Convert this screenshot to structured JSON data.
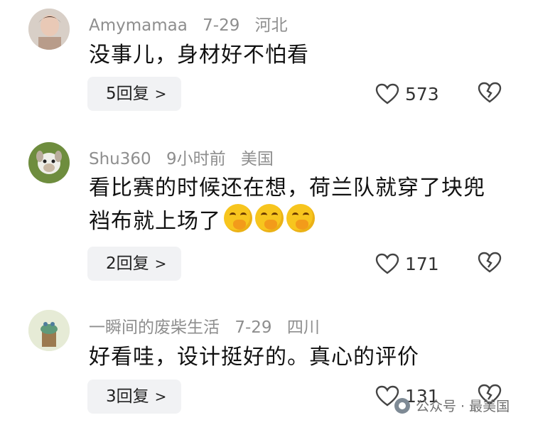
{
  "comments": [
    {
      "username": "Amymamaa",
      "date": "7-29",
      "location": "河北",
      "text": "没事儿，身材好不怕看",
      "replies_label": "5回复",
      "likes": "573"
    },
    {
      "username": "Shu360",
      "date": "9小时前",
      "location": "美国",
      "text": "看比赛的时候还在想，荷兰队就穿了块兜裆布就上场了",
      "emojis": [
        "face-with-hand-over-mouth",
        "face-with-hand-over-mouth",
        "face-with-hand-over-mouth"
      ],
      "replies_label": "2回复",
      "likes": "171"
    },
    {
      "username": "一瞬间的废柴生活",
      "date": "7-29",
      "location": "四川",
      "text": "好看哇，设计挺好的。真心的评价",
      "replies_label": "3回复",
      "likes": "131"
    }
  ],
  "icons": {
    "like": "heart-outline-icon",
    "dislike": "broken-heart-icon",
    "reply_chevron": "chevron-right-icon",
    "watermark": "wechat-official-account-icon"
  },
  "watermark": {
    "text": "公众号 · 最美国"
  }
}
